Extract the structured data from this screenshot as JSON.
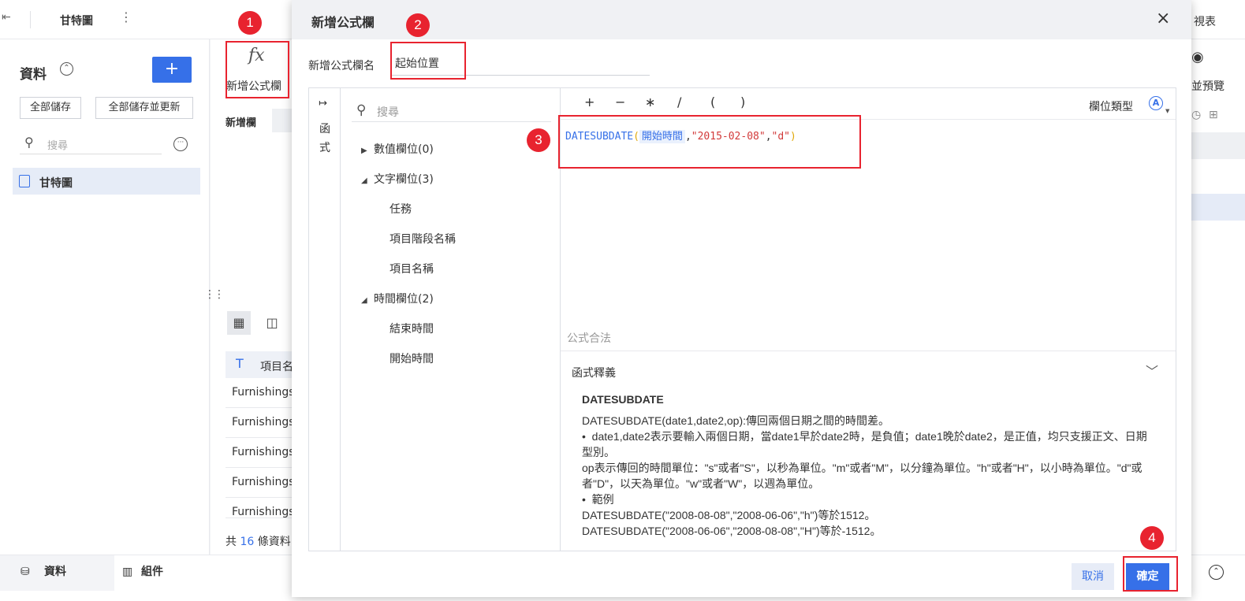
{
  "topbar": {
    "back_icon": "exit-icon",
    "title": "甘特圖",
    "more_icon": "⋮",
    "right_text": "視表"
  },
  "left_panel": {
    "title": "資料",
    "help_icon": "chevron-up-circle-icon",
    "add_label": "+",
    "save_all": "全部儲存",
    "save_update_all": "全部儲存並更新",
    "search_placeholder": "搜尋",
    "more_icon": "···",
    "tree_item": "甘特圖"
  },
  "mid_panel": {
    "fx_icon": "fx",
    "fx_label": "新增公式欄",
    "new_col_tab": "新增欄",
    "column_header": "項目名",
    "rows": [
      "Furnishings",
      "Furnishings",
      "Furnishings",
      "Furnishings",
      "Furnishings"
    ],
    "count_prefix": "共 ",
    "count_num": "16",
    "count_suffix": " 條資料"
  },
  "right_panel": {
    "label": "並預覽"
  },
  "bottom_tabs": {
    "data": "資料",
    "component": "組件"
  },
  "modal": {
    "title": "新增公式欄",
    "close_icon": "×",
    "name_label": "新增公式欄名",
    "name_value": "起始位置",
    "fn_strip_label_1": "函",
    "fn_strip_label_2": "式",
    "search_placeholder": "搜尋",
    "tree": [
      {
        "label": "數值欄位(0)",
        "type": "group",
        "collapsed": true
      },
      {
        "label": "文字欄位(3)",
        "type": "group",
        "collapsed": false
      },
      {
        "label": "任務",
        "type": "leaf"
      },
      {
        "label": "項目階段名稱",
        "type": "leaf"
      },
      {
        "label": "項目名稱",
        "type": "leaf"
      },
      {
        "label": "時間欄位(2)",
        "type": "group",
        "collapsed": false
      },
      {
        "label": "結束時間",
        "type": "leaf"
      },
      {
        "label": "開始時間",
        "type": "leaf"
      }
    ],
    "operators": [
      "+",
      "−",
      "∗",
      "/",
      "(",
      ")"
    ],
    "type_label": "欄位類型",
    "type_icon": "A",
    "formula": {
      "fn": "DATESUBDATE",
      "open": "(",
      "field": "開始時間",
      "comma1": ",",
      "str1": "\"2015-02-08\"",
      "comma2": ",",
      "str2": "\"d\"",
      "close": ")"
    },
    "status": "公式合法",
    "definition": {
      "title": "函式釋義",
      "name": "DATESUBDATE",
      "lines": [
        "DATESUBDATE(date1,date2,op):傳回兩個日期之間的時間差。",
        "•  date1,date2表示要輸入兩個日期，當date1早於date2時，是負值；date1晚於date2，是正值，均只支援正文、日期型別。",
        "op表示傳回的時間單位：\"s\"或者\"S\"，以秒為單位。\"m\"或者\"M\"，以分鐘為單位。\"h\"或者\"H\"，以小時為單位。\"d\"或者\"D\"，以天為單位。\"w\"或者\"W\"，以週為單位。",
        "•  範例",
        "DATESUBDATE(\"2008-08-08\",\"2008-06-06\",\"h\")等於1512。",
        "DATESUBDATE(\"2008-06-06\",\"2008-08-08\",\"H\")等於-1512。"
      ]
    },
    "cancel_label": "取消",
    "ok_label": "確定"
  },
  "annotations": [
    "1",
    "2",
    "3",
    "4"
  ],
  "colors": {
    "accent": "#3670e8",
    "annotation_red": "#e8232f"
  }
}
